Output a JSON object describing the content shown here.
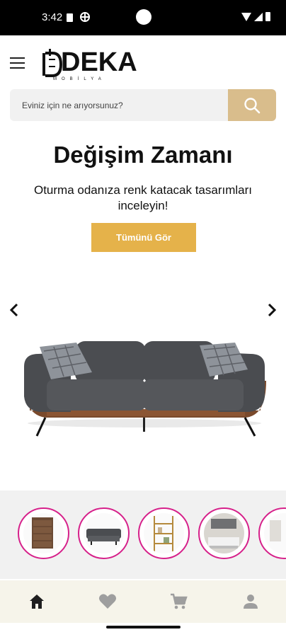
{
  "status_bar": {
    "time": "3:42"
  },
  "header": {
    "logo_text": "DEKA",
    "logo_sub": "MOBİLYA"
  },
  "search": {
    "placeholder": "Eviniz için ne arıyorsunuz?"
  },
  "hero": {
    "title": "Değişim Zamanı",
    "subtitle": "Oturma odanıza renk katacak tasarımları inceleyin!",
    "cta_label": "Tümünü Gör"
  },
  "categories": [
    {
      "icon": "dresser-image"
    },
    {
      "icon": "sofa-image"
    },
    {
      "icon": "bookshelf-image"
    },
    {
      "icon": "living-room-image"
    },
    {
      "icon": "decor-image"
    }
  ],
  "bottom_nav": {
    "items": [
      "home-icon",
      "heart-icon",
      "cart-icon",
      "profile-icon"
    ],
    "active": "home-icon"
  },
  "colors": {
    "accent": "#e5b24a",
    "search_button": "#d9bd8c",
    "category_ring": "#d6208a",
    "nav_background": "#f6f4ea"
  }
}
